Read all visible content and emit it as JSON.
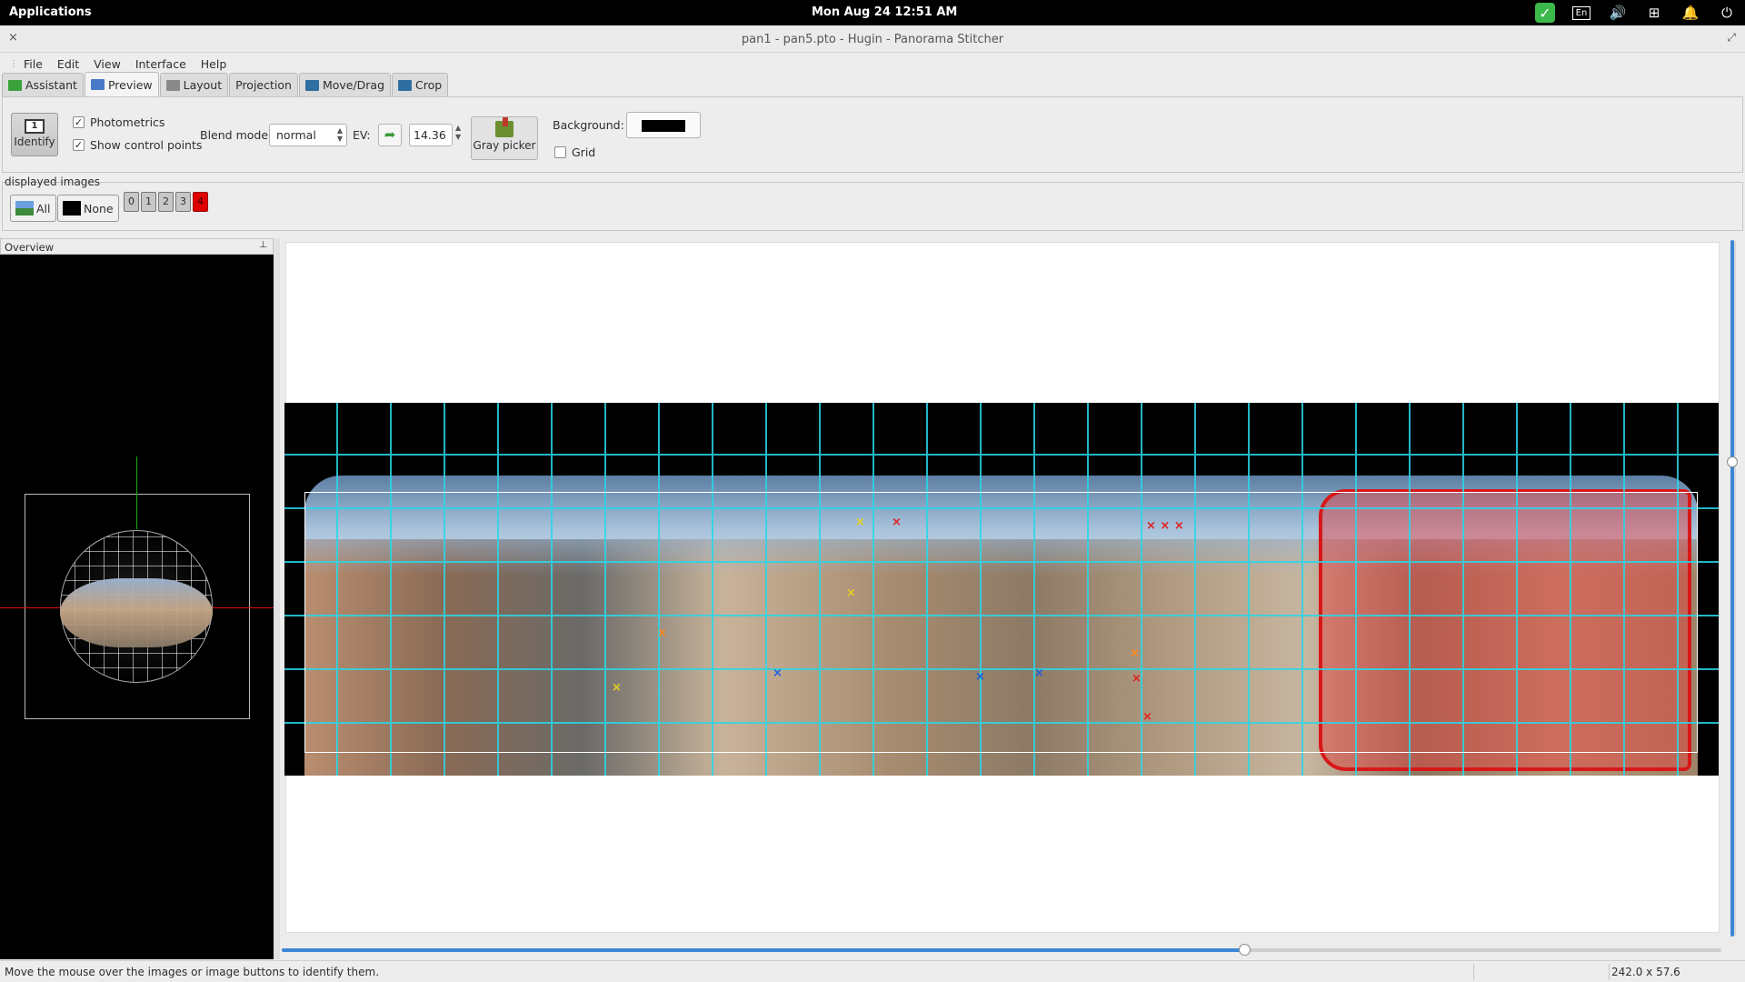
{
  "system_bar": {
    "applications": "Applications",
    "clock": "Mon Aug 24   12:51 AM",
    "keyboard_layout": "En",
    "icons": [
      "check-icon",
      "keyboard-layout-icon",
      "volume-icon",
      "network-icon",
      "notification-icon",
      "power-icon"
    ]
  },
  "window": {
    "title": "pan1 - pan5.pto - Hugin - Panorama Stitcher",
    "close_glyph": "×",
    "max_glyph": "⤢"
  },
  "menu": [
    "File",
    "Edit",
    "View",
    "Interface",
    "Help"
  ],
  "tabs": [
    {
      "label": "Assistant",
      "color": "#3aa13a"
    },
    {
      "label": "Preview",
      "color": "#4a79c7"
    },
    {
      "label": "Layout",
      "color": "#8a8a8a"
    },
    {
      "label": "Projection",
      "color": ""
    },
    {
      "label": "Move/Drag",
      "color": "#2f6ea0"
    },
    {
      "label": "Crop",
      "color": "#2f6ea0"
    }
  ],
  "toolbar": {
    "identify_label": "Identify",
    "identify_number": "1",
    "photometrics_label": "Photometrics",
    "photometrics_checked": true,
    "show_cp_label": "Show control points",
    "show_cp_checked": true,
    "blend_mode_label": "Blend mode:",
    "blend_mode_value": "normal",
    "ev_label": "EV:",
    "ev_value": "14.36",
    "gray_picker_label": "Gray picker",
    "background_label": "Background:",
    "background_color": "#000000",
    "grid_label": "Grid",
    "grid_checked": false,
    "check_glyph": "✓"
  },
  "displayed_images": {
    "label": "displayed images",
    "all_label": "All",
    "none_label": "None",
    "numbers": [
      "0",
      "1",
      "2",
      "3",
      "4"
    ],
    "selected": "4"
  },
  "overview": {
    "title": "Overview",
    "pin_glyph": "⊥"
  },
  "status": {
    "message": "Move the mouse over the images or image buttons to identify them.",
    "dimensions": "242.0 x 57.6"
  }
}
